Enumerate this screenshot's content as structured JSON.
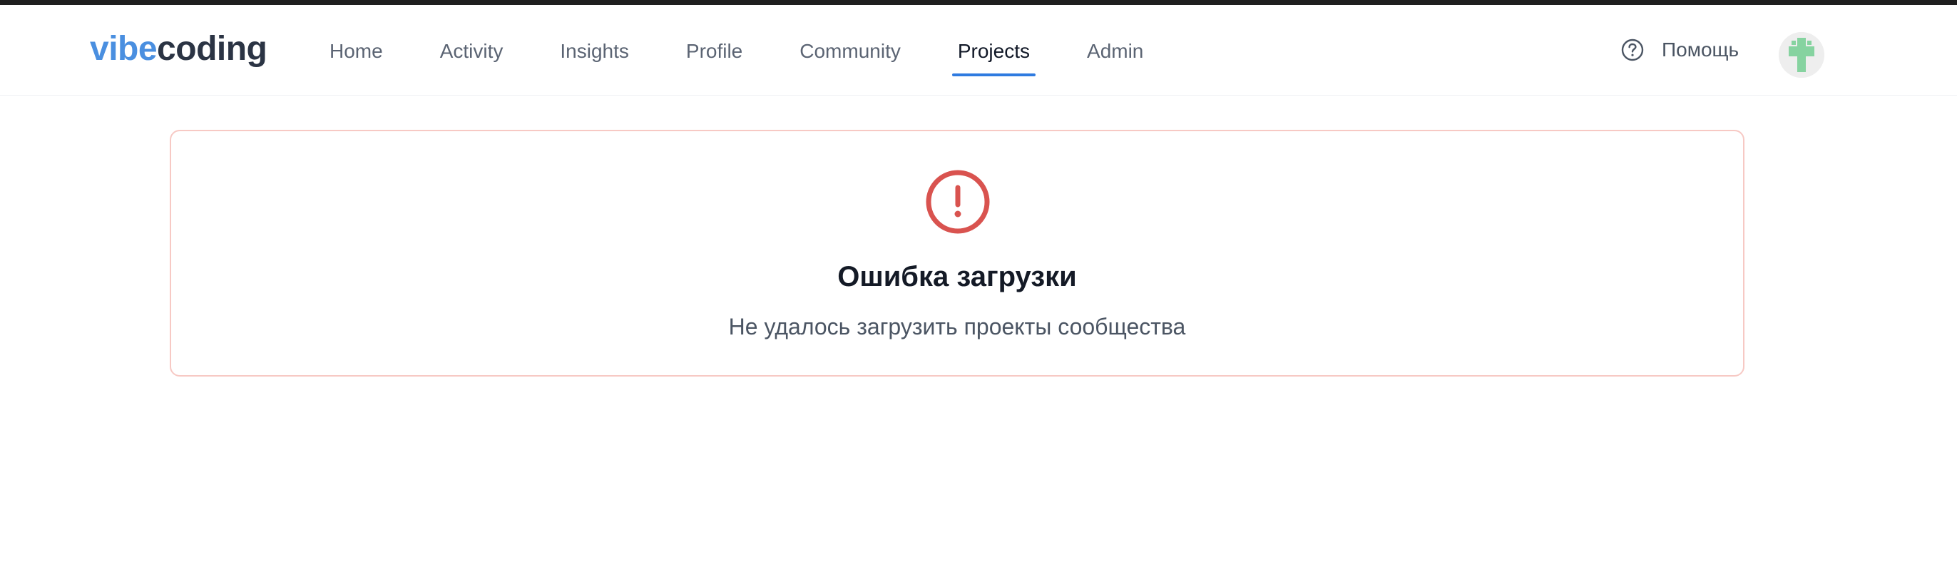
{
  "app": {
    "brand_part_1": "vibe",
    "brand_part_2": "coding"
  },
  "nav": {
    "items": [
      {
        "label": "Home",
        "active": false
      },
      {
        "label": "Activity",
        "active": false
      },
      {
        "label": "Insights",
        "active": false
      },
      {
        "label": "Profile",
        "active": false
      },
      {
        "label": "Community",
        "active": false
      },
      {
        "label": "Projects",
        "active": true
      },
      {
        "label": "Admin",
        "active": false
      }
    ]
  },
  "header": {
    "help_label": "Помощь",
    "help_icon": "question-circle-icon",
    "avatar_icon": "identicon-avatar"
  },
  "error": {
    "icon": "alert-circle-icon",
    "title": "Ошибка загрузки",
    "message": "Не удалось загрузить проекты сообщества"
  },
  "colors": {
    "brand_accent": "#4a8fe0",
    "brand_dark": "#2b3444",
    "active_underline": "#2f7be0",
    "error_red": "#d9534f",
    "error_border": "#f7c9c4",
    "avatar_green": "#86d3a0"
  }
}
